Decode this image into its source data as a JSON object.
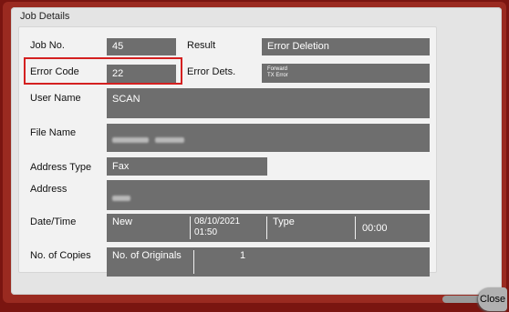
{
  "window": {
    "title": "Job Details"
  },
  "fields": {
    "job_no_label": "Job No.",
    "job_no_value": "45",
    "result_label": "Result",
    "result_value": "Error Deletion",
    "error_code_label": "Error Code",
    "error_code_value": "22",
    "error_dets_label": "Error Dets.",
    "error_dets_line1": "Forward",
    "error_dets_line2": "TX Error",
    "user_name_label": "User Name",
    "user_name_value": "SCAN",
    "file_name_label": "File Name",
    "address_type_label": "Address Type",
    "address_type_value": "Fax",
    "address_label": "Address",
    "datetime_label": "Date/Time",
    "datetime_status": "New",
    "datetime_date": "08/10/2021",
    "datetime_time": "01:50",
    "type_label": "Type",
    "type_value": "00:00",
    "copies_label": "No. of Copies",
    "originals_label": "No. of Originals",
    "originals_value": "1"
  },
  "buttons": {
    "close_label": "Close"
  },
  "colors": {
    "highlight": "#d42020",
    "field_bg": "#6e6e6e",
    "frame": "#9a2a20"
  }
}
